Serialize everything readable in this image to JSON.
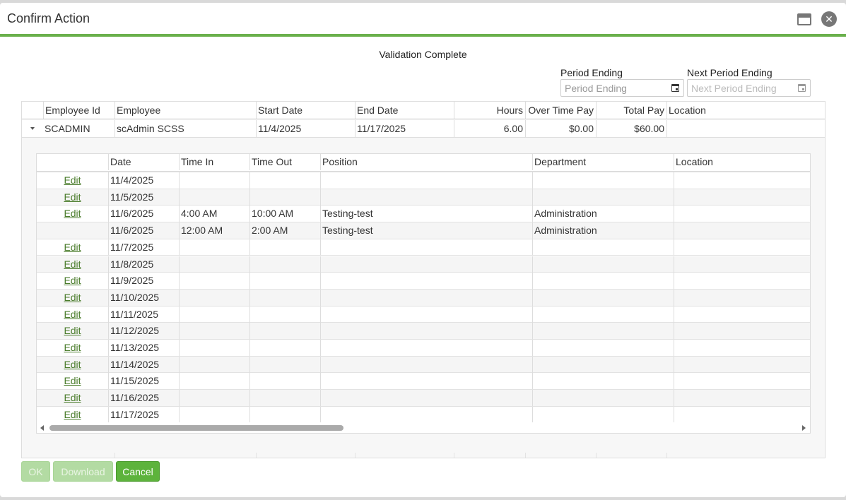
{
  "dialog": {
    "title": "Confirm Action",
    "heading": "Validation Complete"
  },
  "filters": {
    "period_ending_label": "Period Ending",
    "period_ending_placeholder": "Period Ending",
    "next_period_ending_label": "Next Period Ending",
    "next_period_ending_placeholder": "Next Period Ending"
  },
  "outer_grid": {
    "columns": [
      "Employee Id",
      "Employee",
      "Start Date",
      "End Date",
      "Hours",
      "Over Time Pay",
      "Total Pay",
      "Location"
    ],
    "row": {
      "employee_id": "SCADMIN",
      "employee": "scAdmin SCSS",
      "start_date": "11/4/2025",
      "end_date": "11/17/2025",
      "hours": "6.00",
      "over_time_pay": "$0.00",
      "total_pay": "$60.00",
      "location": ""
    }
  },
  "inner_grid": {
    "columns": [
      "",
      "Date",
      "Time In",
      "Time Out",
      "Position",
      "Department",
      "Location"
    ],
    "edit_label": "Edit",
    "rows": [
      {
        "edit": "Edit",
        "date": "11/4/2025",
        "time_in": "",
        "time_out": "",
        "position": "",
        "department": "",
        "location": ""
      },
      {
        "edit": "Edit",
        "date": "11/5/2025",
        "time_in": "",
        "time_out": "",
        "position": "",
        "department": "",
        "location": ""
      },
      {
        "edit": "Edit",
        "date": "11/6/2025",
        "time_in": "4:00 AM",
        "time_out": "10:00 AM",
        "position": "Testing-test",
        "department": "Administration",
        "location": ""
      },
      {
        "edit": "",
        "date": "11/6/2025",
        "time_in": "12:00 AM",
        "time_out": "2:00 AM",
        "position": "Testing-test",
        "department": "Administration",
        "location": ""
      },
      {
        "edit": "Edit",
        "date": "11/7/2025",
        "time_in": "",
        "time_out": "",
        "position": "",
        "department": "",
        "location": ""
      },
      {
        "edit": "Edit",
        "date": "11/8/2025",
        "time_in": "",
        "time_out": "",
        "position": "",
        "department": "",
        "location": ""
      },
      {
        "edit": "Edit",
        "date": "11/9/2025",
        "time_in": "",
        "time_out": "",
        "position": "",
        "department": "",
        "location": ""
      },
      {
        "edit": "Edit",
        "date": "11/10/2025",
        "time_in": "",
        "time_out": "",
        "position": "",
        "department": "",
        "location": ""
      },
      {
        "edit": "Edit",
        "date": "11/11/2025",
        "time_in": "",
        "time_out": "",
        "position": "",
        "department": "",
        "location": ""
      },
      {
        "edit": "Edit",
        "date": "11/12/2025",
        "time_in": "",
        "time_out": "",
        "position": "",
        "department": "",
        "location": ""
      },
      {
        "edit": "Edit",
        "date": "11/13/2025",
        "time_in": "",
        "time_out": "",
        "position": "",
        "department": "",
        "location": ""
      },
      {
        "edit": "Edit",
        "date": "11/14/2025",
        "time_in": "",
        "time_out": "",
        "position": "",
        "department": "",
        "location": ""
      },
      {
        "edit": "Edit",
        "date": "11/15/2025",
        "time_in": "",
        "time_out": "",
        "position": "",
        "department": "",
        "location": ""
      },
      {
        "edit": "Edit",
        "date": "11/16/2025",
        "time_in": "",
        "time_out": "",
        "position": "",
        "department": "",
        "location": ""
      },
      {
        "edit": "Edit",
        "date": "11/17/2025",
        "time_in": "",
        "time_out": "",
        "position": "",
        "department": "",
        "location": ""
      }
    ]
  },
  "buttons": {
    "ok": "OK",
    "download": "Download",
    "cancel": "Cancel"
  },
  "icons": {
    "maximize": "window-maximize-icon",
    "close": "close-icon",
    "calendar": "calendar-icon",
    "expand": "caret-down-icon"
  },
  "colors": {
    "accent": "#6ab04c",
    "link": "#4a7c2b"
  }
}
